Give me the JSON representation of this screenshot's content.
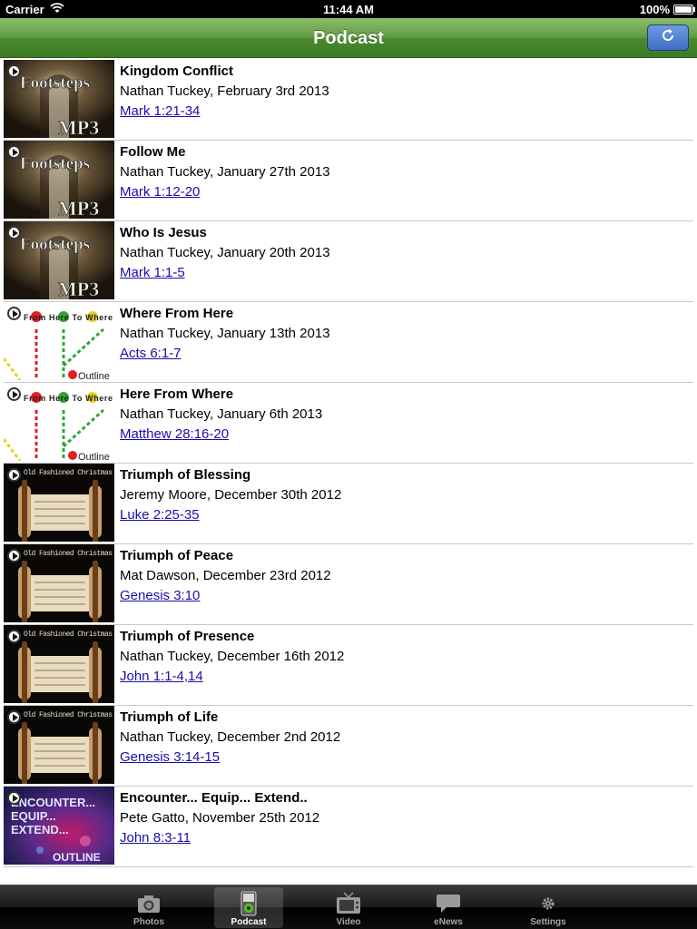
{
  "status_bar": {
    "carrier": "Carrier",
    "time": "11:44 AM",
    "battery": "100%"
  },
  "nav": {
    "title": "Podcast"
  },
  "podcasts": [
    {
      "title": "Kingdom Conflict",
      "subtitle": "Nathan Tuckey, February 3rd 2013",
      "reference": "Mark 1:21-34",
      "thumb": "footsteps"
    },
    {
      "title": "Follow Me",
      "subtitle": "Nathan Tuckey, January 27th 2013",
      "reference": "Mark 1:12-20",
      "thumb": "footsteps"
    },
    {
      "title": "Who Is Jesus",
      "subtitle": "Nathan Tuckey, January 20th 2013",
      "reference": "Mark 1:1-5",
      "thumb": "footsteps"
    },
    {
      "title": "Where From Here",
      "subtitle": "Nathan Tuckey, January 13th 2013",
      "reference": "Acts 6:1-7",
      "thumb": "fromhere"
    },
    {
      "title": "Here From Where",
      "subtitle": "Nathan Tuckey, January 6th 2013",
      "reference": "Matthew 28:16-20",
      "thumb": "fromhere"
    },
    {
      "title": "Triumph of Blessing",
      "subtitle": "Jeremy Moore, December 30th 2012",
      "reference": "Luke 2:25-35",
      "thumb": "scroll"
    },
    {
      "title": "Triumph of Peace",
      "subtitle": "Mat Dawson, December 23rd 2012",
      "reference": "Genesis 3:10",
      "thumb": "scroll"
    },
    {
      "title": "Triumph of Presence",
      "subtitle": "Nathan Tuckey, December 16th 2012",
      "reference": "John 1:1-4,14",
      "thumb": "scroll"
    },
    {
      "title": "Triumph of Life",
      "subtitle": "Nathan Tuckey, December 2nd 2012",
      "reference": "Genesis 3:14-15",
      "thumb": "scroll"
    },
    {
      "title": "Encounter... Equip... Extend..",
      "subtitle": "Pete Gatto, November 25th 2012",
      "reference": "John 8:3-11",
      "thumb": "encounter"
    }
  ],
  "thumb_text": {
    "footsteps": {
      "line1": "Footsteps",
      "line2": "MP3"
    },
    "fromhere": {
      "line1": "From Here To Where",
      "line2": "Outline"
    },
    "scroll": {
      "line1": "Old Fashioned Christmas"
    },
    "encounter": {
      "line1": "ENCOUNTER...",
      "line2": "EQUIP...",
      "line3": "EXTEND...",
      "line4": "OUTLINE"
    }
  },
  "tabs": [
    {
      "label": "Photos",
      "icon": "camera-icon"
    },
    {
      "label": "Podcast",
      "icon": "ipod-icon",
      "selected": true
    },
    {
      "label": "Video",
      "icon": "tv-icon"
    },
    {
      "label": "eNews",
      "icon": "speech-bubble-icon"
    },
    {
      "label": "Settings",
      "icon": "gear-icon"
    }
  ],
  "colors": {
    "nav_green": "#4b8a2e",
    "link_blue": "#1a0dab",
    "refresh_blue": "#3d6fc9"
  }
}
